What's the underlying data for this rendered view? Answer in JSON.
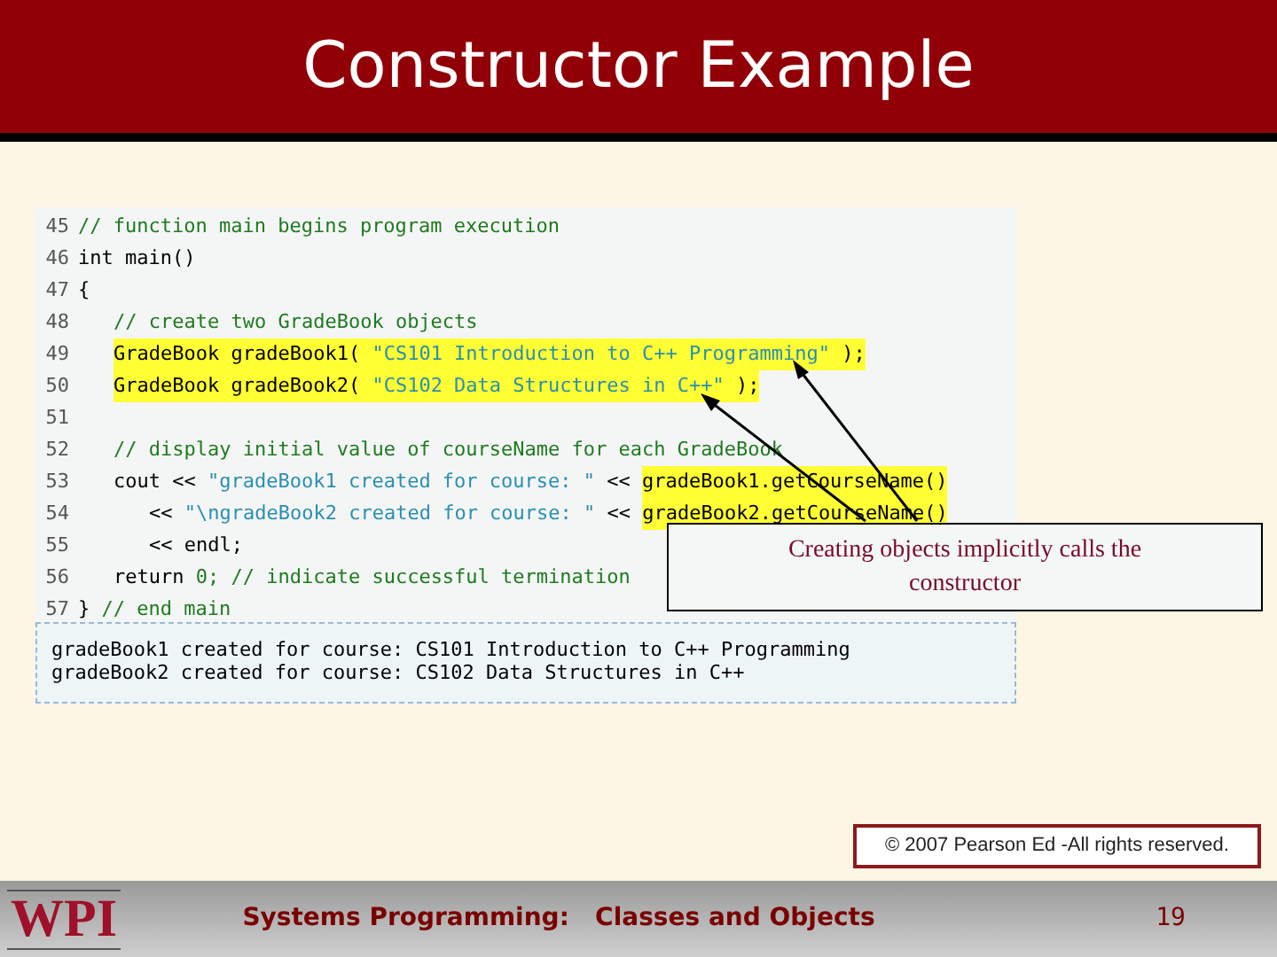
{
  "title": "Constructor Example",
  "code_lines": [
    {
      "number": "45",
      "kind": "top",
      "segments": [
        {
          "text": "// function main begins program execution",
          "kind": "comment",
          "highlighted": false
        }
      ]
    },
    {
      "number": "46",
      "kind": "top",
      "segments": [
        {
          "text": "int main()",
          "kind": "code",
          "highlighted": false
        }
      ]
    },
    {
      "number": "47",
      "kind": "top",
      "segments": [
        {
          "text": "{",
          "kind": "code",
          "highlighted": false
        }
      ]
    },
    {
      "number": "48",
      "kind": "body",
      "segments": [
        {
          "text": "// create two GradeBook objects",
          "kind": "comment",
          "highlighted": false
        }
      ]
    },
    {
      "number": "49",
      "kind": "body",
      "segments": [
        {
          "text": "GradeBook gradeBook1( ",
          "kind": "code",
          "highlighted": true
        },
        {
          "text": "\"CS101 Introduction to C++ Programming\"",
          "kind": "string",
          "highlighted": true
        },
        {
          "text": " );",
          "kind": "code",
          "highlighted": true
        }
      ]
    },
    {
      "number": "50",
      "kind": "body",
      "segments": [
        {
          "text": "GradeBook gradeBook2( ",
          "kind": "code",
          "highlighted": true
        },
        {
          "text": "\"CS102 Data Structures in C++\"",
          "kind": "string",
          "highlighted": true
        },
        {
          "text": " );",
          "kind": "code",
          "highlighted": true
        }
      ]
    },
    {
      "number": "51",
      "kind": "top"
    },
    {
      "number": "52",
      "kind": "body",
      "segments": [
        {
          "text": "// display initial value of courseName for each GradeBook",
          "kind": "comment",
          "highlighted": false
        }
      ]
    },
    {
      "number": "53",
      "kind": "body",
      "segments": [
        {
          "text": "cout << ",
          "kind": "code",
          "highlighted": false
        },
        {
          "text": "\"gradeBook1 created for course: \"",
          "kind": "string",
          "highlighted": false
        },
        {
          "text": " << ",
          "kind": "code",
          "highlighted": false
        },
        {
          "text": "gradeBook1.getCourseName()",
          "kind": "code",
          "highlighted": true
        }
      ]
    },
    {
      "number": "54",
      "kind": "continuation",
      "segments": [
        {
          "text": "<< ",
          "kind": "code",
          "highlighted": false
        },
        {
          "text": "\"\\ngradeBook2 created for course: \"",
          "kind": "string",
          "highlighted": false
        },
        {
          "text": " << ",
          "kind": "code",
          "highlighted": false
        },
        {
          "text": "gradeBook2.getCourseName()",
          "kind": "code",
          "highlighted": true
        }
      ]
    },
    {
      "number": "55",
      "kind": "continuation",
      "segments": [
        {
          "text": "<< endl;",
          "kind": "code",
          "highlighted": false
        }
      ]
    },
    {
      "number": "56",
      "kind": "body",
      "segments": [
        {
          "text": "return ",
          "kind": "code",
          "highlighted": false
        },
        {
          "text": "0",
          "kind": "number",
          "highlighted": false
        },
        {
          "text": "; // indicate successful termination",
          "kind": "comment",
          "highlighted": false
        }
      ]
    },
    {
      "number": "57",
      "kind": "top",
      "segments": [
        {
          "text": "} ",
          "kind": "code",
          "highlighted": false
        },
        {
          "text": "// end main",
          "kind": "comment",
          "highlighted": false
        }
      ]
    }
  ],
  "output_lines": [
    "gradeBook1 created for course: CS101 Introduction to C++ Programming",
    "gradeBook2 created for course: CS102 Data Structures in C++"
  ],
  "callout": "Creating objects implicitly calls the constructor",
  "copyright": "© 2007 Pearson Ed -All rights reserved.",
  "footer": {
    "logo": "WPI",
    "title": "Systems Programming:   Classes and Objects",
    "page": "19"
  }
}
